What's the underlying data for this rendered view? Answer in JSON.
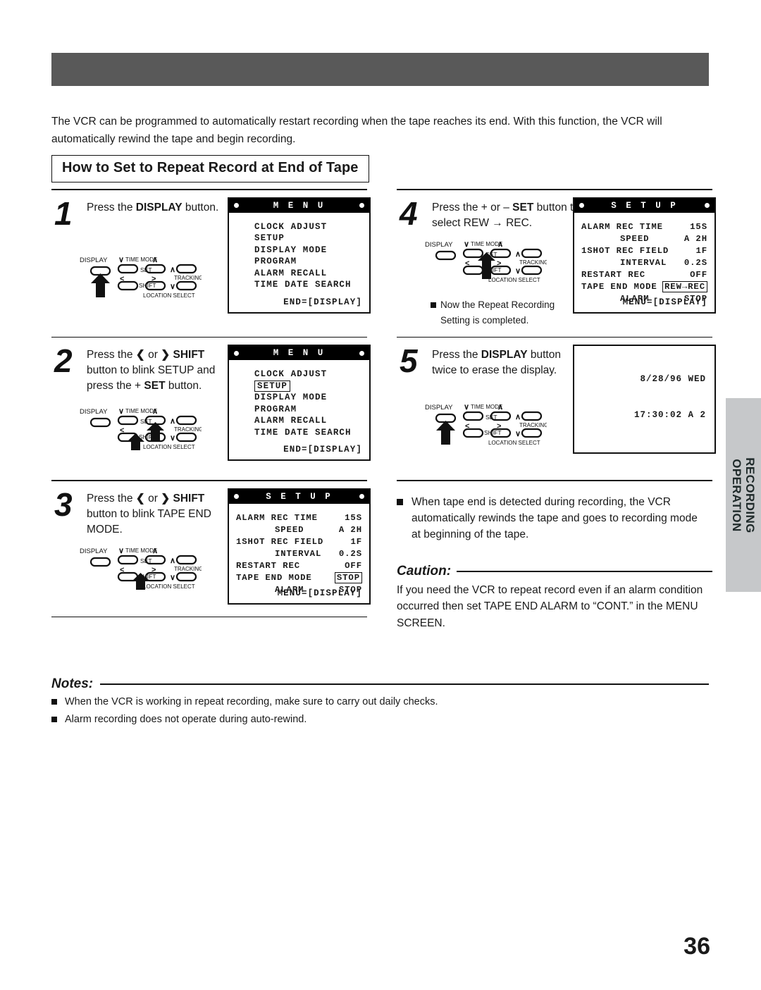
{
  "header": {
    "bar_color": "#595959"
  },
  "intro": "The VCR can be programmed to automatically restart recording when the tape reaches its end. With this function, the VCR will automatically rewind the tape and begin recording.",
  "section_title": "How to Set to Repeat Record at End of Tape",
  "steps": {
    "s1": {
      "num": "1",
      "text_html": "Press the <b>DISPLAY</b> button."
    },
    "s2": {
      "num": "2",
      "text_html": "Press the <b>&#10094;</b> or <b>&#10095;</b> <b>SHIFT</b> button to blink SETUP and press the + <b>SET</b> button."
    },
    "s3": {
      "num": "3",
      "text_html": "Press the <b>&#10094;</b> or <b>&#10095;</b> <b>SHIFT</b> button to blink TAPE END MODE."
    },
    "s4": {
      "num": "4",
      "text_html": "Press the + or &#8211; <b>SET</b> button to select REW &#8594; REC.",
      "note": "Now the Repeat Recording",
      "note2": "Setting is completed."
    },
    "s5": {
      "num": "5",
      "text_html": "Press the <b>DISPLAY</b> button twice to erase the display."
    }
  },
  "osd": {
    "menu": {
      "title": "M E N U",
      "items": [
        "CLOCK ADJUST",
        "SETUP",
        "DISPLAY MODE",
        "PROGRAM",
        "ALARM RECALL",
        "TIME DATE SEARCH"
      ],
      "footer": "END=[DISPLAY]",
      "highlight": null
    },
    "menu_selected": {
      "title": "M E N U",
      "items": [
        "CLOCK ADJUST",
        "SETUP",
        "DISPLAY MODE",
        "PROGRAM",
        "ALARM RECALL",
        "TIME DATE SEARCH"
      ],
      "footer": "END=[DISPLAY]",
      "highlight": "SETUP"
    },
    "setup_stop": {
      "title": "S E T U P",
      "rows": [
        {
          "label": "ALARM REC TIME",
          "value": "15S",
          "boxed": false
        },
        {
          "label": "SPEED",
          "value": "A 2H",
          "boxed": false,
          "indent": true
        },
        {
          "label": "1SHOT REC FIELD",
          "value": "1F",
          "boxed": false
        },
        {
          "label": "INTERVAL",
          "value": "0.2S",
          "boxed": false,
          "indent": true
        },
        {
          "label": "RESTART REC",
          "value": "OFF",
          "boxed": false
        },
        {
          "label": "TAPE END MODE",
          "value": "STOP",
          "boxed": true
        },
        {
          "label": "ALARM",
          "value": "STOP",
          "boxed": false,
          "indent": true
        }
      ],
      "footer": "MENU=[DISPLAY]"
    },
    "setup_rew": {
      "title": "S E T U P",
      "rows": [
        {
          "label": "ALARM REC TIME",
          "value": "15S",
          "boxed": false
        },
        {
          "label": "SPEED",
          "value": "A 2H",
          "boxed": false,
          "indent": true
        },
        {
          "label": "1SHOT REC FIELD",
          "value": "1F",
          "boxed": false
        },
        {
          "label": "INTERVAL",
          "value": "0.2S",
          "boxed": false,
          "indent": true
        },
        {
          "label": "RESTART REC",
          "value": "OFF",
          "boxed": false
        },
        {
          "label": "TAPE END MODE",
          "value": "REW→REC",
          "boxed": true
        },
        {
          "label": "ALARM",
          "value": "STOP",
          "boxed": false,
          "indent": true
        }
      ],
      "footer": "MENU=[DISPLAY]"
    },
    "blank_screen": {
      "date": "8/28/96 WED",
      "time": "17:30:02 A 2"
    }
  },
  "remote": {
    "display_label": "DISPLAY",
    "time_mode_label": "TIME MODE",
    "set_label": "SET",
    "shift_label": "SHIFT",
    "tracking_label": "TRACKING",
    "location_select_label": "LOCATION SELECT",
    "minus_glyph": "∨",
    "plus_glyph": "∧",
    "left_glyph": "〈",
    "right_glyph": "〉",
    "up_glyph": "∧",
    "down_glyph": "∨"
  },
  "tape_end_bullet": "When tape end is detected during recording, the VCR automatically rewinds the tape and goes to recording mode at beginning of the tape.",
  "caution": {
    "heading": "Caution:",
    "body": "If you need the VCR to repeat record even if an alarm condition occurred then set TAPE END ALARM to “CONT.” in the MENU SCREEN."
  },
  "notes": {
    "heading": "Notes:",
    "items": [
      "When the VCR is working in repeat recording, make sure to carry out daily checks.",
      "Alarm recording does not operate during auto-rewind."
    ]
  },
  "side_tab": {
    "line1": "RECORDING",
    "line2": "OPERATION",
    "color": "#c6c8ca"
  },
  "page_number": "36"
}
